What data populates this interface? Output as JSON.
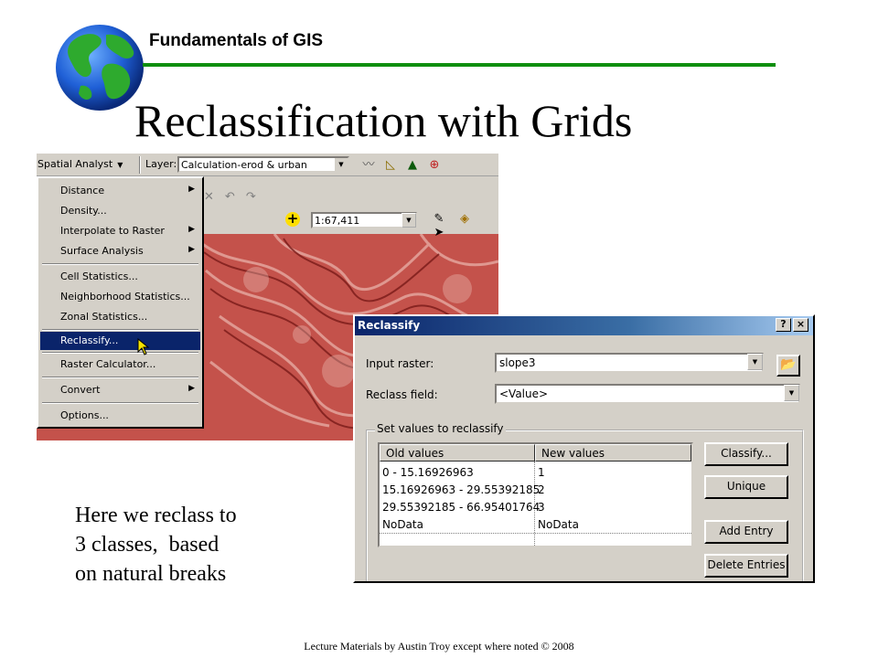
{
  "header": {
    "course": "Fundamentals of GIS",
    "title": "Reclassification with Grids"
  },
  "arcmap": {
    "spatial_analyst_label": "Spatial Analyst",
    "layer_label": "Layer:",
    "layer_value": "Calculation-erod & urban",
    "scale_value": "1:67,411",
    "menu_items": [
      {
        "label": "Distance",
        "submenu": true
      },
      {
        "label": "Density...",
        "submenu": false
      },
      {
        "label": "Interpolate to Raster",
        "submenu": true
      },
      {
        "label": "Surface Analysis",
        "submenu": true
      },
      {
        "label": "Cell Statistics...",
        "submenu": false
      },
      {
        "label": "Neighborhood Statistics...",
        "submenu": false
      },
      {
        "label": "Zonal Statistics...",
        "submenu": false
      },
      {
        "label": "Reclassify...",
        "submenu": false,
        "highlighted": true
      },
      {
        "label": "Raster Calculator...",
        "submenu": false
      },
      {
        "label": "Convert",
        "submenu": true
      },
      {
        "label": "Options...",
        "submenu": false
      }
    ]
  },
  "dialog": {
    "title": "Reclassify",
    "help_btn": "?",
    "close_btn": "×",
    "input_raster_label": "Input raster:",
    "input_raster_value": "slope3",
    "reclass_field_label": "Reclass field:",
    "reclass_field_value": "<Value>",
    "group_label": "Set values to reclassify",
    "columns": [
      "Old values",
      "New values"
    ],
    "rows": [
      {
        "old": "0 - 15.16926963",
        "new": "1"
      },
      {
        "old": "15.16926963 - 29.55392185",
        "new": "2"
      },
      {
        "old": "29.55392185 - 66.95401764",
        "new": "3"
      },
      {
        "old": "NoData",
        "new": "NoData"
      }
    ],
    "buttons": {
      "classify": "Classify...",
      "unique": "Unique",
      "add_entry": "Add Entry",
      "delete_entries": "Delete Entries"
    }
  },
  "note_lines": [
    "Here we reclass to",
    "3 classes,  based",
    "on natural breaks"
  ],
  "footer": "Lecture Materials by Austin Troy except where noted © 2008",
  "colors": {
    "rule": "#0f8f0f",
    "menu_highlight": "#0a246a",
    "map_relief": "#b8433d"
  }
}
